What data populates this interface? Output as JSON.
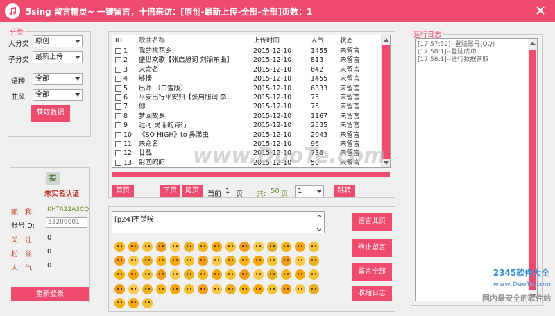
{
  "window": {
    "title": "5sing 留言精灵~ 一键留言，十倍来访：[原创-最新上传-全部-全部]页数：1"
  },
  "category": {
    "group_label": "分类",
    "main_label": "大分类",
    "main_value": "原创",
    "sub_label": "子分类",
    "sub_value": "最新上传",
    "lang_label": "语种",
    "lang_value": "全部",
    "style_label": "曲风",
    "style_value": "全部",
    "fetch_button": "获取数据"
  },
  "account": {
    "status_icon_char": "实",
    "status_text": "未实名认证",
    "nickname_label": "昵　称:",
    "nickname_value": "KHTA22A3CQ",
    "id_label": "账号ID:",
    "id_value": "53209001",
    "follow_label": "关　注:",
    "follow_value": "0",
    "fans_label": "粉　丝:",
    "fans_value": "0",
    "popularity_label": "人　气:",
    "popularity_value": "0",
    "relogin_button": "重新登录"
  },
  "song_list": {
    "headers": {
      "id": "ID",
      "name": "歌曲名称",
      "time": "上传时间",
      "pop": "人气",
      "status": "状态"
    },
    "rows": [
      {
        "id": "1",
        "name": "我的桃花乡",
        "time": "2015-12-10",
        "pop": "1455",
        "status": "未留言"
      },
      {
        "id": "2",
        "name": "盛世欢歌【张启旭词 刘渝东曲】",
        "time": "2015-12-10",
        "pop": "813",
        "status": "未留言"
      },
      {
        "id": "3",
        "name": "未命名",
        "time": "2015-12-10",
        "pop": "642",
        "status": "未留言"
      },
      {
        "id": "4",
        "name": "够揍",
        "time": "2015-12-10",
        "pop": "1455",
        "status": "未留言"
      },
      {
        "id": "5",
        "name": "出师 （白雪版）",
        "time": "2015-12-10",
        "pop": "6333",
        "status": "未留言"
      },
      {
        "id": "6",
        "name": "平安出行平安归【张启旭词 李...",
        "time": "2015-12-10",
        "pop": "75",
        "status": "未留言"
      },
      {
        "id": "7",
        "name": "你",
        "time": "2015-12-10",
        "pop": "75",
        "status": "未留言"
      },
      {
        "id": "8",
        "name": "梦回故乡",
        "time": "2015-12-10",
        "pop": "1167",
        "status": "未留言"
      },
      {
        "id": "9",
        "name": "运河 民谣的诗行",
        "time": "2015-12-10",
        "pop": "2535",
        "status": "未留言"
      },
      {
        "id": "10",
        "name": "《SO HIGH》to 鼻涕虫",
        "time": "2015-12-10",
        "pop": "2043",
        "status": "未留言"
      },
      {
        "id": "11",
        "name": "未命名",
        "time": "2015-12-10",
        "pop": "96",
        "status": "未留言"
      },
      {
        "id": "12",
        "name": "廿载",
        "time": "2015-12-10",
        "pop": "738",
        "status": "未留言"
      },
      {
        "id": "13",
        "name": "彩回昭昭",
        "time": "2015-12-10",
        "pop": "50",
        "status": "未留言"
      }
    ]
  },
  "pager": {
    "first": "首页",
    "next": "下页",
    "last": "尾页",
    "current_prefix": "当前",
    "current_page": "1",
    "page_unit": "页",
    "total_prefix": "共:",
    "total_pages": "50",
    "total_unit": "页",
    "page_select": "1",
    "jump": "跳转"
  },
  "comment": {
    "text": "[p24]不错唉"
  },
  "actions": {
    "comment_page": "留言此页",
    "stop": "终止留言",
    "comment_all": "留言全部",
    "collapse_log": "收缩日志"
  },
  "log": {
    "group_label": "运行日志",
    "lines": [
      "[17:57:52]--登陆账号(QQ)",
      "[17:58:1]--登陆成功",
      "[17:58:1]--进行数据获取"
    ]
  },
  "watermark": {
    "site": "www.DuoTe.com",
    "brand": "2345软件大全",
    "brand_url": "www.DuoTe.com",
    "brand_slogan": "国内最安全的软件站"
  },
  "colors": {
    "accent": "#ee4b6e"
  }
}
